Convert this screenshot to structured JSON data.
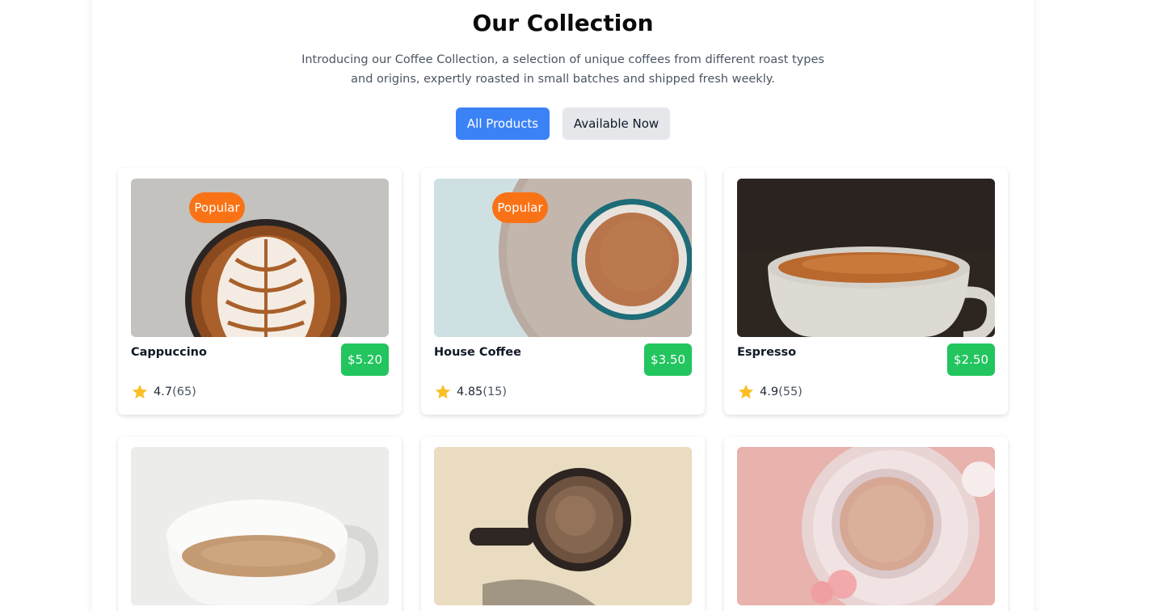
{
  "header": {
    "title": "Our Collection",
    "intro": "Introducing our Coffee Collection, a selection of unique coffees from different roast types and origins, expertly roasted in small batches and shipped fresh weekly."
  },
  "filters": {
    "all_label": "All Products",
    "available_label": "Available Now",
    "active": "All Products"
  },
  "colors": {
    "accent": "#3b82f6",
    "popular_badge": "#f97316",
    "price_badge": "#22c55e",
    "star": "#fbbf24"
  },
  "products": [
    {
      "name": "Cappuccino",
      "price": "$5.20",
      "rating": "4.7",
      "votes": "(65)",
      "badge": "Popular",
      "image_icon": "cappuccino-latte-art-photo"
    },
    {
      "name": "House Coffee",
      "price": "$3.50",
      "rating": "4.85",
      "votes": "(15)",
      "badge": "Popular",
      "image_icon": "house-coffee-cup-photo"
    },
    {
      "name": "Espresso",
      "price": "$2.50",
      "rating": "4.9",
      "votes": "(55)",
      "image_icon": "espresso-cup-photo"
    },
    {
      "image_icon": "white-mug-coffee-photo"
    },
    {
      "image_icon": "black-coffee-top-photo"
    },
    {
      "image_icon": "pink-latte-flowers-photo"
    }
  ]
}
